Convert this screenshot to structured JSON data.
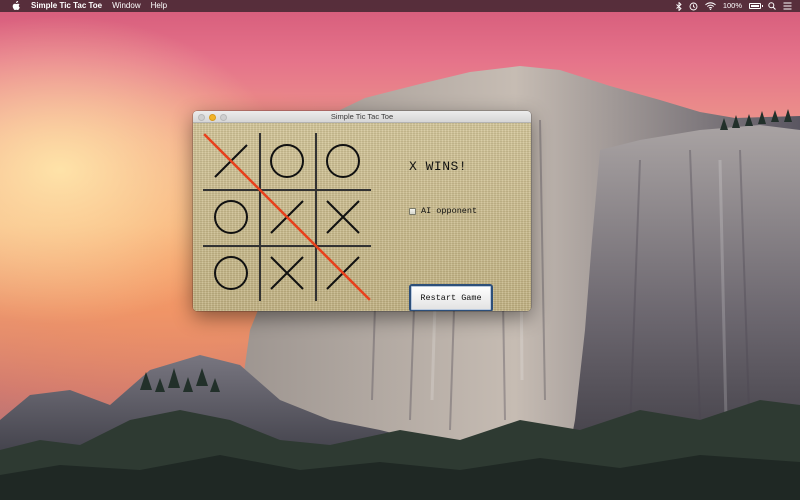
{
  "menubar": {
    "apple_icon": "apple-icon",
    "app_name": "Simple Tic Tac Toe",
    "menus": [
      "Window",
      "Help"
    ],
    "status": {
      "battery_percent": "100%",
      "battery_level": 1.0,
      "icons": [
        "bluetooth-icon",
        "time-machine-icon",
        "wifi-icon",
        "battery-icon",
        "search-icon",
        "notification-center-icon"
      ]
    }
  },
  "window": {
    "title": "Simple Tic Tac Toe",
    "board": {
      "cells": [
        "X",
        "O",
        "O",
        "O",
        "X",
        "X",
        "O",
        "X",
        "X"
      ],
      "winning_line": [
        0,
        4,
        8
      ],
      "mark_color": "#111111",
      "win_line_color": "#e8401c"
    },
    "status_text": "X WINS!",
    "ai_opponent": {
      "label": "AI opponent",
      "checked": false
    },
    "restart_label": "Restart Game"
  }
}
